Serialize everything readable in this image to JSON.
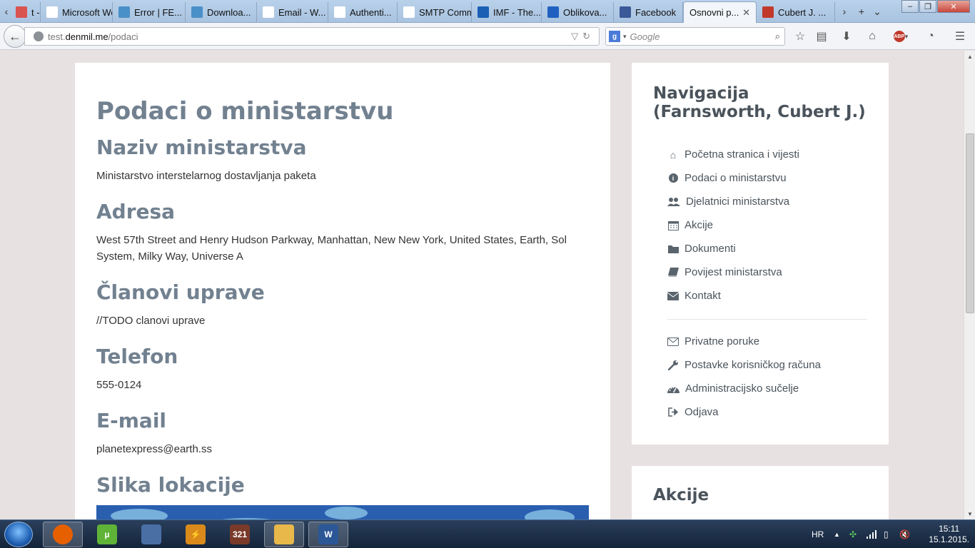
{
  "browser": {
    "tabs": [
      {
        "label": "t - ...",
        "icon": "generic-page-icon",
        "color": "#d9534f"
      },
      {
        "label": "Microsoft Wo...",
        "icon": "generic-page-icon",
        "color": "#ffffff"
      },
      {
        "label": "Error | FE...",
        "icon": "oth-icon",
        "color": "#4a90c8"
      },
      {
        "label": "Downloa...",
        "icon": "oth-icon",
        "color": "#4a90c8"
      },
      {
        "label": "Email - W...",
        "icon": "wikipedia-icon",
        "color": "#ffffff"
      },
      {
        "label": "Authenti...",
        "icon": "doc-icon",
        "color": "#ffffff"
      },
      {
        "label": "SMTP Comm...",
        "icon": "generic-page-icon",
        "color": "#ffffff"
      },
      {
        "label": "IMF - The...",
        "icon": "imf-icon",
        "color": "#1a5fb4"
      },
      {
        "label": "Oblikova...",
        "icon": "f2-icon",
        "color": "#2060c0"
      },
      {
        "label": "Facebook",
        "icon": "facebook-icon",
        "color": "#3b5998"
      },
      {
        "label": "Osnovni p...",
        "icon": "none",
        "color": "#ffffff",
        "active": true
      },
      {
        "label": "Cubert J. ...",
        "icon": "futurama-icon",
        "color": "#c0392b"
      }
    ],
    "url": {
      "prefix": "test.",
      "host": "denmil.me",
      "path": "/podaci"
    },
    "search_placeholder": "Google",
    "search_engine_letter": "g",
    "win_controls": {
      "minimize": "‒",
      "maximize": "❐",
      "close": "✕"
    }
  },
  "page": {
    "title": "Podaci o ministarstvu",
    "sections": [
      {
        "heading": "Naziv ministarstva",
        "text": "Ministarstvo interstelarnog dostavljanja paketa"
      },
      {
        "heading": "Adresa",
        "text": "West 57th Street and Henry Hudson Parkway, Manhattan, New New York, United States, Earth, Sol System, Milky Way, Universe A"
      },
      {
        "heading": "Članovi uprave",
        "text": "//TODO clanovi uprave"
      },
      {
        "heading": "Telefon",
        "text": "555-0124"
      },
      {
        "heading": "E-mail",
        "text": "planetexpress@earth.ss"
      },
      {
        "heading": "Slika lokacije",
        "text": ""
      }
    ]
  },
  "sidebar": {
    "title": "Navigacija (Farnsworth, Cubert J.)",
    "main_items": [
      {
        "label": "Početna stranica i vijesti",
        "icon": "home-icon"
      },
      {
        "label": "Podaci o ministarstvu",
        "icon": "info-icon"
      },
      {
        "label": "Djelatnici ministarstva",
        "icon": "users-icon"
      },
      {
        "label": "Akcije",
        "icon": "calendar-icon"
      },
      {
        "label": "Dokumenti",
        "icon": "folder-icon"
      },
      {
        "label": "Povijest ministarstva",
        "icon": "book-icon"
      },
      {
        "label": "Kontakt",
        "icon": "envelope-icon"
      }
    ],
    "user_items": [
      {
        "label": "Privatne poruke",
        "icon": "envelope-outline-icon"
      },
      {
        "label": "Postavke korisničkog računa",
        "icon": "wrench-icon"
      },
      {
        "label": "Administracijsko sučelje",
        "icon": "dashboard-icon"
      },
      {
        "label": "Odjava",
        "icon": "sign-out-icon"
      }
    ],
    "second_card_title": "Akcije"
  },
  "taskbar": {
    "apps": [
      {
        "name": "firefox",
        "label": "",
        "color": "#e66000",
        "active": true
      },
      {
        "name": "utorrent",
        "label": "µ",
        "color": "#5fb336"
      },
      {
        "name": "network-tool",
        "label": "",
        "color": "#4a6fa5"
      },
      {
        "name": "winamp",
        "label": "⚡",
        "color": "#d98a1a"
      },
      {
        "name": "calendar-app",
        "label": "321",
        "color": "#7a3a2a"
      },
      {
        "name": "explorer",
        "label": "",
        "color": "#e8b84a",
        "active": true
      },
      {
        "name": "word",
        "label": "W",
        "color": "#2b5797",
        "active": true
      }
    ],
    "language": "HR",
    "time": "15:11",
    "date": "15.1.2015."
  }
}
